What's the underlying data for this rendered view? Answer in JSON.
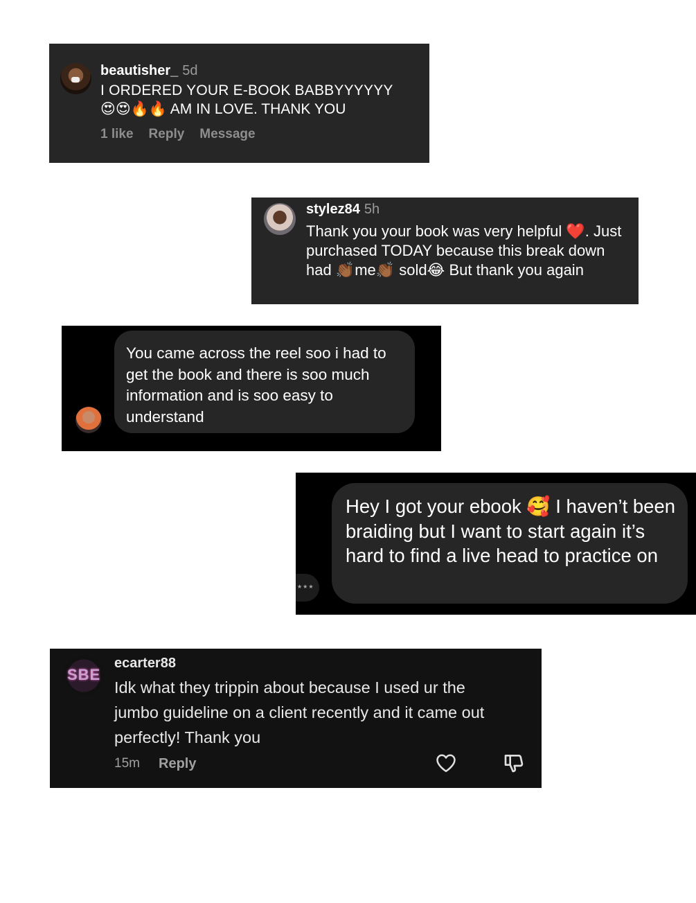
{
  "comments": [
    {
      "username": "beautisher_",
      "time": "5d",
      "line1": "I ORDERED YOUR E-BOOK BABBYYYYYY",
      "line2": "😍😍🔥🔥 AM IN LOVE. THANK YOU",
      "likes": "1 like",
      "reply": "Reply",
      "message": "Message"
    },
    {
      "username": "stylez84",
      "time": "5h",
      "text": "Thank you your book was very helpful ❤️. Just purchased TODAY because this break down had 👏🏾me👏🏾 sold😂  But thank you again"
    },
    {
      "text": "You came across the reel soo i had to get the book and there is soo much information and is soo easy to understand"
    },
    {
      "text": "Hey I got your ebook 🥰 I haven’t been braiding but I want to start again it’s hard to find a live head to practice on"
    },
    {
      "username": "ecarter88",
      "text": "Idk what they trippin about because I used ur the jumbo guideline on a client recently and it came out perfectly! Thank you",
      "time": "15m",
      "reply": "Reply"
    }
  ]
}
